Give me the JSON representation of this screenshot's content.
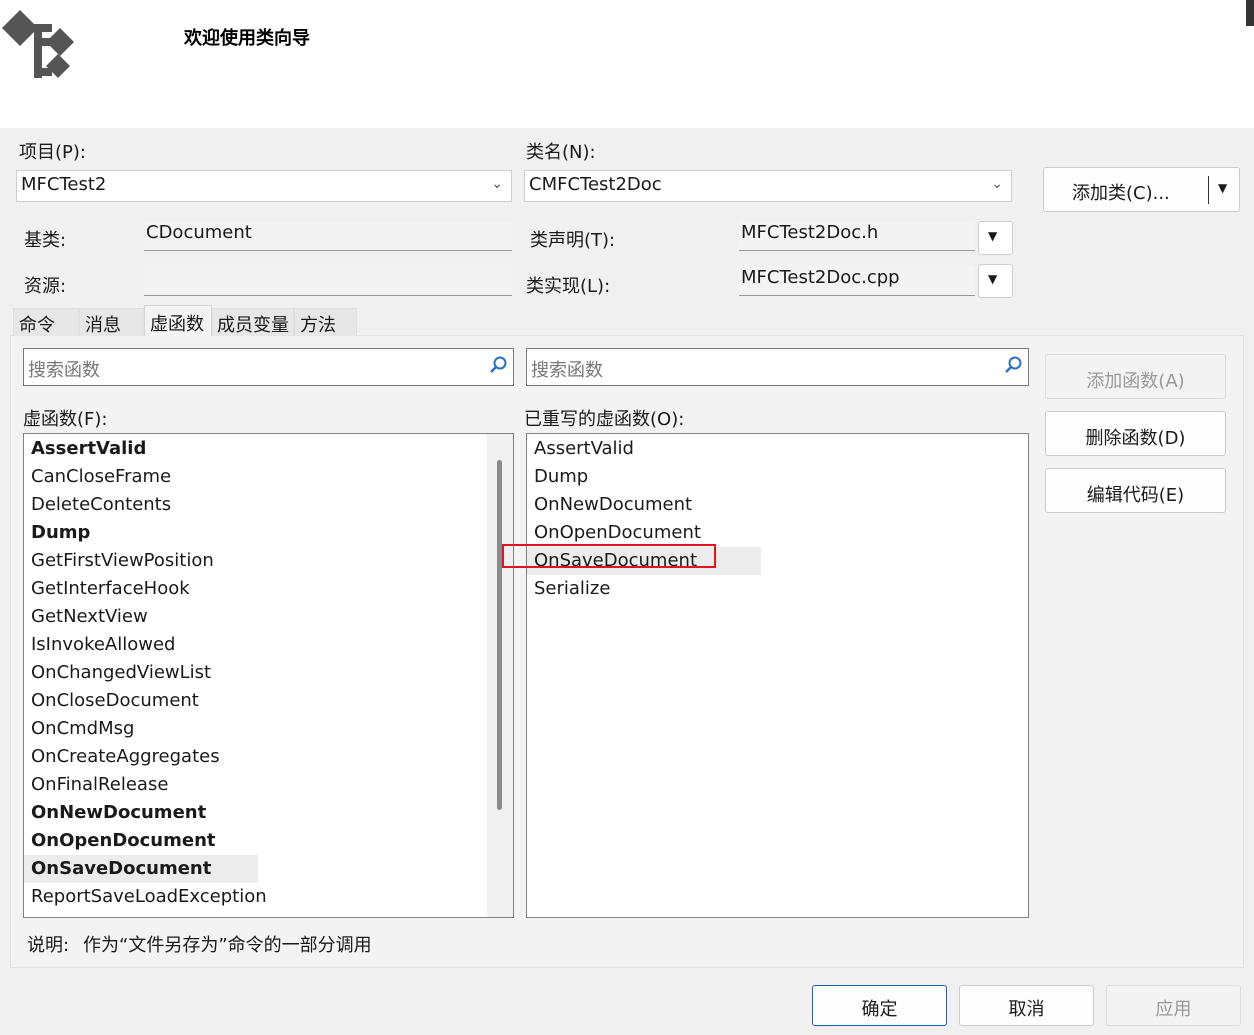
{
  "header": {
    "title": "欢迎使用类向导"
  },
  "labels": {
    "project": "项目(P):",
    "class_name": "类名(N):",
    "base_class": "基类:",
    "resource": "资源:",
    "class_declaration": "类声明(T):",
    "class_implementation": "类实现(L):"
  },
  "fields": {
    "project": "MFCTest2",
    "class_name": "CMFCTest2Doc",
    "base_class": "CDocument",
    "resource": "",
    "class_declaration": "MFCTest2Doc.h",
    "class_implementation": "MFCTest2Doc.cpp"
  },
  "add_class_button": "添加类(C)...",
  "tabs": [
    {
      "label": "命令",
      "active": false
    },
    {
      "label": "消息",
      "active": false
    },
    {
      "label": "虚函数",
      "active": true
    },
    {
      "label": "成员变量",
      "active": false
    },
    {
      "label": "方法",
      "active": false
    }
  ],
  "search": {
    "left_placeholder": "搜索函数",
    "right_placeholder": "搜索函数"
  },
  "virtual_functions": {
    "label": "虚函数(F):",
    "items": [
      {
        "name": "AssertValid",
        "bold": true
      },
      {
        "name": "CanCloseFrame",
        "bold": false
      },
      {
        "name": "DeleteContents",
        "bold": false
      },
      {
        "name": "Dump",
        "bold": true
      },
      {
        "name": "GetFirstViewPosition",
        "bold": false
      },
      {
        "name": "GetInterfaceHook",
        "bold": false
      },
      {
        "name": "GetNextView",
        "bold": false
      },
      {
        "name": "IsInvokeAllowed",
        "bold": false
      },
      {
        "name": "OnChangedViewList",
        "bold": false
      },
      {
        "name": "OnCloseDocument",
        "bold": false
      },
      {
        "name": "OnCmdMsg",
        "bold": false
      },
      {
        "name": "OnCreateAggregates",
        "bold": false
      },
      {
        "name": "OnFinalRelease",
        "bold": false
      },
      {
        "name": "OnNewDocument",
        "bold": true
      },
      {
        "name": "OnOpenDocument",
        "bold": true
      },
      {
        "name": "OnSaveDocument",
        "bold": true,
        "selected": true
      },
      {
        "name": "ReportSaveLoadException",
        "bold": false
      }
    ]
  },
  "overridden_functions": {
    "label": "已重写的虚函数(O):",
    "items": [
      {
        "name": "AssertValid"
      },
      {
        "name": "Dump"
      },
      {
        "name": "OnNewDocument"
      },
      {
        "name": "OnOpenDocument"
      },
      {
        "name": "OnSaveDocument",
        "selected": true,
        "highlighted": true
      },
      {
        "name": "Serialize"
      }
    ]
  },
  "side_buttons": {
    "add_function": "添加函数(A)",
    "delete_function": "删除函数(D)",
    "edit_code": "编辑代码(E)"
  },
  "description": {
    "label": "说明:",
    "text": "作为“文件另存为”命令的一部分调用"
  },
  "footer": {
    "ok": "确定",
    "cancel": "取消",
    "apply": "应用"
  },
  "colors": {
    "highlight_border": "#e0141e",
    "primary_border": "#1f5fb3",
    "selection_bg": "#ececec"
  }
}
